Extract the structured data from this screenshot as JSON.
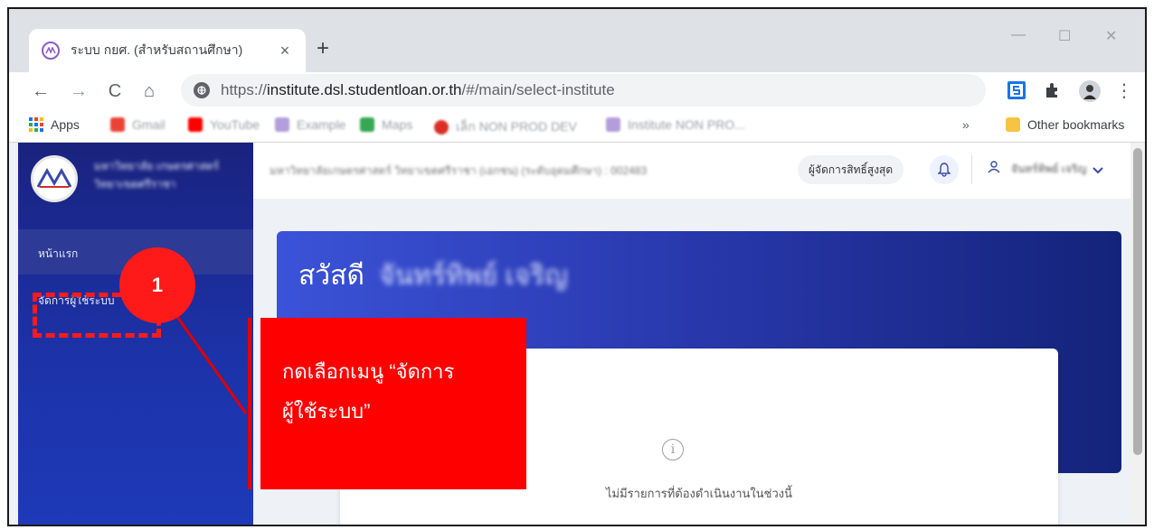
{
  "browser": {
    "tab_title": "ระบบ กยศ. (สำหรับสถานศึกษา)",
    "tab_close": "×",
    "new_tab": "+",
    "window_minimize": "—",
    "window_maximize": "☐",
    "window_close": "✕",
    "back": "←",
    "forward": "→",
    "reload": "C",
    "home": "⌂",
    "url_scheme": "https://",
    "url_host": "institute.dsl.studentloan.or.th",
    "url_path": "/#/main/select-institute",
    "menu": "⋮"
  },
  "bookmarks": {
    "apps": "Apps",
    "gmail": "Gmail",
    "youtube": "YouTube",
    "example": "Example",
    "maps": "Maps",
    "nonprod": "เล็ก NON PROD DEV",
    "institute": "Institute NON PRO...",
    "more": "»",
    "other": "Other bookmarks"
  },
  "app": {
    "university_name": "มหาวิทยาลัย เกษตรศาสตร์ วิทยาเขตศรีราชา",
    "menu_home": "หน้าแรก",
    "menu_user_management": "จัดการผู้ใช้ระบบ",
    "topbar_title": "มหาวิทยาลัยเกษตรศาสตร์ วิทยาเขตศรีราชา (เอกชน) (ระดับอุดมศึกษา) : 002483",
    "role_badge": "ผู้จัดการสิทธิ์สูงสุด",
    "user_name": "จันทร์ทิพย์ เจริญ",
    "greeting": "สวัสดี",
    "greeting_name": "จันทร์ทิพย์ เจริญ",
    "info_icon": "i",
    "empty_message": "ไม่มีรายการที่ต้องดำเนินงานในช่วงนี้"
  },
  "annotation": {
    "step_number": "1",
    "callout_text": "กดเลือกเมนู “จัดการ\nผู้ใช้ระบบ”",
    "color": "#ff0000"
  }
}
